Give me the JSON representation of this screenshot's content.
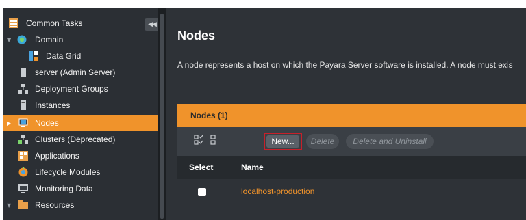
{
  "sidebar": {
    "collapse_glyph": "◀◀",
    "items": [
      {
        "label": "Common Tasks",
        "icon": "common-tasks-icon",
        "expanded": null,
        "selected": false
      },
      {
        "label": "Domain",
        "icon": "domain-icon",
        "expanded": true,
        "selected": false
      },
      {
        "label": "Data Grid",
        "icon": "data-grid-icon",
        "expanded": null,
        "selected": false
      },
      {
        "label": "server (Admin Server)",
        "icon": "server-icon",
        "expanded": null,
        "selected": false
      },
      {
        "label": "Deployment Groups",
        "icon": "deployment-groups-icon",
        "expanded": null,
        "selected": false
      },
      {
        "label": "Instances",
        "icon": "instances-icon",
        "expanded": null,
        "selected": false
      },
      {
        "label": "Nodes",
        "icon": "nodes-icon",
        "expanded": false,
        "selected": true
      },
      {
        "label": "Clusters (Deprecated)",
        "icon": "clusters-icon",
        "expanded": null,
        "selected": false
      },
      {
        "label": "Applications",
        "icon": "applications-icon",
        "expanded": null,
        "selected": false
      },
      {
        "label": "Lifecycle Modules",
        "icon": "lifecycle-modules-icon",
        "expanded": null,
        "selected": false
      },
      {
        "label": "Monitoring Data",
        "icon": "monitoring-data-icon",
        "expanded": null,
        "selected": false
      },
      {
        "label": "Resources",
        "icon": "resources-icon",
        "expanded": true,
        "selected": false
      }
    ]
  },
  "main": {
    "title": "Nodes",
    "description": "A node represents a host on which the Payara Server software is installed. A node must exis",
    "table": {
      "title": "Nodes (1)",
      "toolbar": {
        "new_label": "New...",
        "delete_label": "Delete",
        "delete_uninstall_label": "Delete and Uninstall"
      },
      "columns": [
        "Select",
        "Name"
      ],
      "rows": [
        {
          "selected": false,
          "name": "localhost-production"
        }
      ]
    }
  },
  "colors": {
    "accent": "#f0932b",
    "sidebar_bg": "#2b2f34",
    "main_bg": "#2e3237",
    "highlight_border": "#c8202a"
  }
}
